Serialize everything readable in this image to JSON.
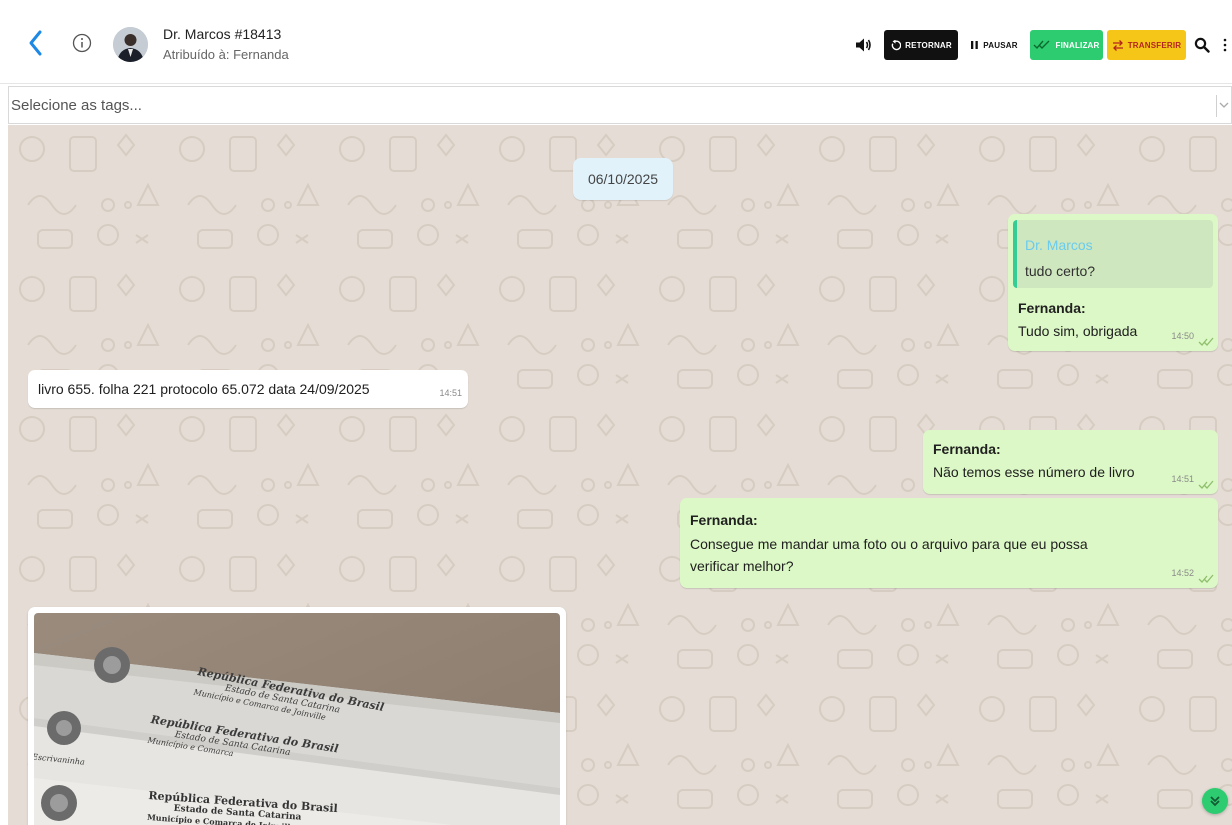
{
  "header": {
    "contact_name": "Dr. Marcos #18413",
    "assigned_to": "Atribuído à: Fernanda",
    "buttons": {
      "retornar": "RETORNAR",
      "pausar": "PAUSAR",
      "finalizar": "FINALIZAR",
      "transferir": "TRANSFERIR"
    },
    "icons": [
      "back-chevron-icon",
      "info-icon",
      "speaker-icon",
      "undo-icon",
      "pause-icon",
      "double-check-icon",
      "transfer-arrows-icon",
      "search-icon",
      "more-vertical-icon"
    ]
  },
  "tags": {
    "placeholder": "Selecione as tags..."
  },
  "chat": {
    "date_separator": "06/10/2025",
    "messages": [
      {
        "direction": "out",
        "quoted_author": "Dr. Marcos",
        "quoted_text": "tudo certo?",
        "sender": "Fernanda:",
        "text": "Tudo sim, obrigada",
        "time": "14:50"
      },
      {
        "direction": "in",
        "text": "livro 655. folha 221 protocolo 65.072 data 24/09/2025",
        "time": "14:51"
      },
      {
        "direction": "out",
        "sender": "Fernanda:",
        "text": "Não temos esse número de livro",
        "time": "14:51"
      },
      {
        "direction": "out",
        "sender": "Fernanda:",
        "text_line1": "Consegue me mandar uma foto ou o arquivo para que eu possa",
        "text_line2": "verificar melhor?",
        "time": "14:52"
      }
    ],
    "photo_lines": [
      {
        "l1": "República Federativa do Brasil",
        "l2": "Estado de Santa Catarina",
        "l3": "Município e Comarca de Joinville"
      },
      {
        "l1": "República Federativa do Brasil",
        "l2": "Estado de Santa Catarina",
        "l3": "Município e Comarca"
      },
      {
        "l1": "República Federativa do Brasil",
        "l2": "Estado de Santa Catarina",
        "l3": "Município e Comarca de Joinville"
      }
    ],
    "photo_extra": "Escrivaninha",
    "colors": {
      "background": "#e5ddd5",
      "outgoing_bubble": "#dcf8c6",
      "incoming_bubble": "#ffffff",
      "date_pill": "#e1f2fb",
      "finalizar": "#2ecc71",
      "transferir": "#f5c518",
      "retornar": "#111111",
      "link_blue": "#1e88e5"
    }
  }
}
